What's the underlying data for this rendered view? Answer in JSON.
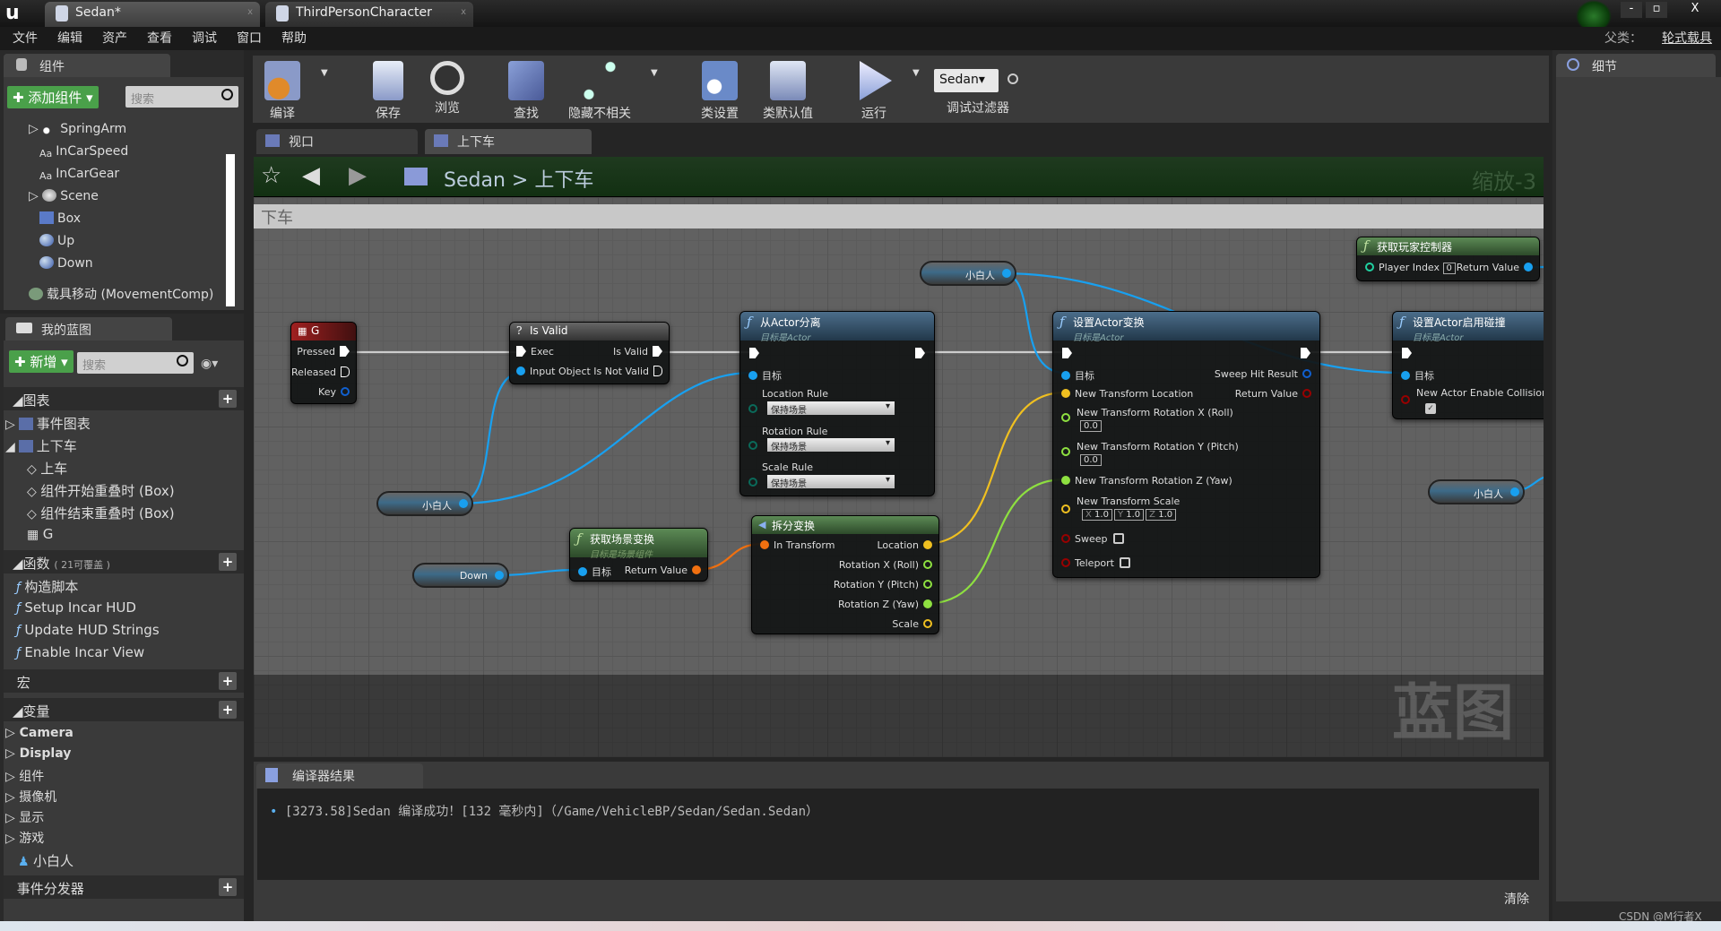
{
  "window": {
    "tabs": [
      {
        "label": "Sedan*"
      },
      {
        "label": "ThirdPersonCharacter"
      }
    ],
    "parent_label": "父类：",
    "parent_value": "轮式载具"
  },
  "menu": [
    "文件",
    "编辑",
    "资产",
    "查看",
    "调试",
    "窗口",
    "帮助"
  ],
  "components": {
    "tab": "组件",
    "add_label": "添加组件",
    "search_placeholder": "搜索",
    "items": [
      "SpringArm",
      "InCarSpeed",
      "InCarGear",
      "Scene",
      "Box",
      "Up",
      "Down"
    ],
    "movement": "载具移动 (MovementComp)"
  },
  "my_blueprint": {
    "tab": "我的蓝图",
    "new_label": "新增",
    "search_placeholder": "搜索",
    "graphs_header": "图表",
    "graphs": [
      "事件图表",
      "上下车"
    ],
    "events": [
      "上车",
      "组件开始重叠时 (Box)",
      "组件结束重叠时 (Box)",
      "G"
    ],
    "functions_header": "函数",
    "functions_note": "( 21可覆盖 )",
    "functions": [
      "构造脚本",
      "Setup Incar HUD",
      "Update HUD Strings",
      "Enable Incar View"
    ],
    "macros_header": "宏",
    "variables_header": "变量",
    "variable_groups": [
      "Camera",
      "Display",
      "组件",
      "摄像机",
      "显示",
      "游戏"
    ],
    "variable": "小白人",
    "dispatchers_header": "事件分发器"
  },
  "toolbar": {
    "compile": "编译",
    "save": "保存",
    "browse": "浏览",
    "find": "查找",
    "hide_unrelated": "隐藏不相关",
    "class_settings": "类设置",
    "class_defaults": "类默认值",
    "play": "运行",
    "debug_object": "Sedan",
    "debug_filter": "调试过滤器"
  },
  "graph_tabs": [
    "视口",
    "上下车"
  ],
  "breadcrumb": {
    "root": "Sedan",
    "sep": ">",
    "current": "上下车",
    "zoom": "缩放-3"
  },
  "comment": "下车",
  "watermark": "蓝图",
  "nodes": {
    "g": {
      "title": "G",
      "pins": [
        "Pressed",
        "Released",
        "Key"
      ]
    },
    "isvalid": {
      "title": "Is Valid",
      "exec": "Exec",
      "input": "Input Object",
      "valid": "Is Valid",
      "notvalid": "Is Not Valid"
    },
    "detach": {
      "title": "从Actor分离",
      "sub": "目标是Actor",
      "target": "目标",
      "loc_rule": "Location Rule",
      "rot_rule": "Rotation Rule",
      "scale_rule": "Scale Rule",
      "rule_value": "保持场景"
    },
    "settransform": {
      "title": "设置Actor变换",
      "sub": "目标是Actor",
      "target": "目标",
      "sweep_hit": "Sweep Hit Result",
      "loc": "New Transform Location",
      "ret": "Return Value",
      "rotx": "New Transform Rotation X (Roll)",
      "rotx_v": "0.0",
      "roty": "New Transform Rotation Y (Pitch)",
      "roty_v": "0.0",
      "rotz": "New Transform Rotation Z (Yaw)",
      "scale": "New Transform Scale",
      "sx": "X",
      "sx_v": "1.0",
      "sy": "Y",
      "sy_v": "1.0",
      "sz": "Z",
      "sz_v": "1.0",
      "sweep": "Sweep",
      "teleport": "Teleport"
    },
    "collision": {
      "title": "设置Actor启用碰撞",
      "sub": "目标是Actor",
      "target": "目标",
      "enable": "New Actor Enable Collision",
      "checked": true
    },
    "controller": {
      "title": "获取玩家控制器",
      "index_label": "Player Index",
      "index": "0",
      "ret": "Return Value"
    },
    "break": {
      "title": "拆分变换",
      "in": "In Transform",
      "loc": "Location",
      "rx": "Rotation X (Roll)",
      "ry": "Rotation Y (Pitch)",
      "rz": "Rotation Z (Yaw)",
      "scale": "Scale"
    },
    "worldtf": {
      "title": "获取场景变换",
      "sub": "目标是场景组件",
      "target": "目标",
      "ret": "Return Value"
    },
    "vars": {
      "xiaobairen": "小白人",
      "down": "Down"
    }
  },
  "compiler": {
    "tab": "编译器结果",
    "message": "[3273.58]Sedan 编译成功！[132 毫秒内]（/Game/VehicleBP/Sedan/Sedan.Sedan）",
    "clear": "清除"
  },
  "details": {
    "tab": "细节"
  },
  "credit": "CSDN @M行者X",
  "colors": {
    "exec": "#ffffff",
    "object": "#18a0f0",
    "vector": "#f0c020",
    "rotator": "#8ee040",
    "transform": "#f07010",
    "bool": "#900000",
    "breadcrumb": "#123012"
  }
}
